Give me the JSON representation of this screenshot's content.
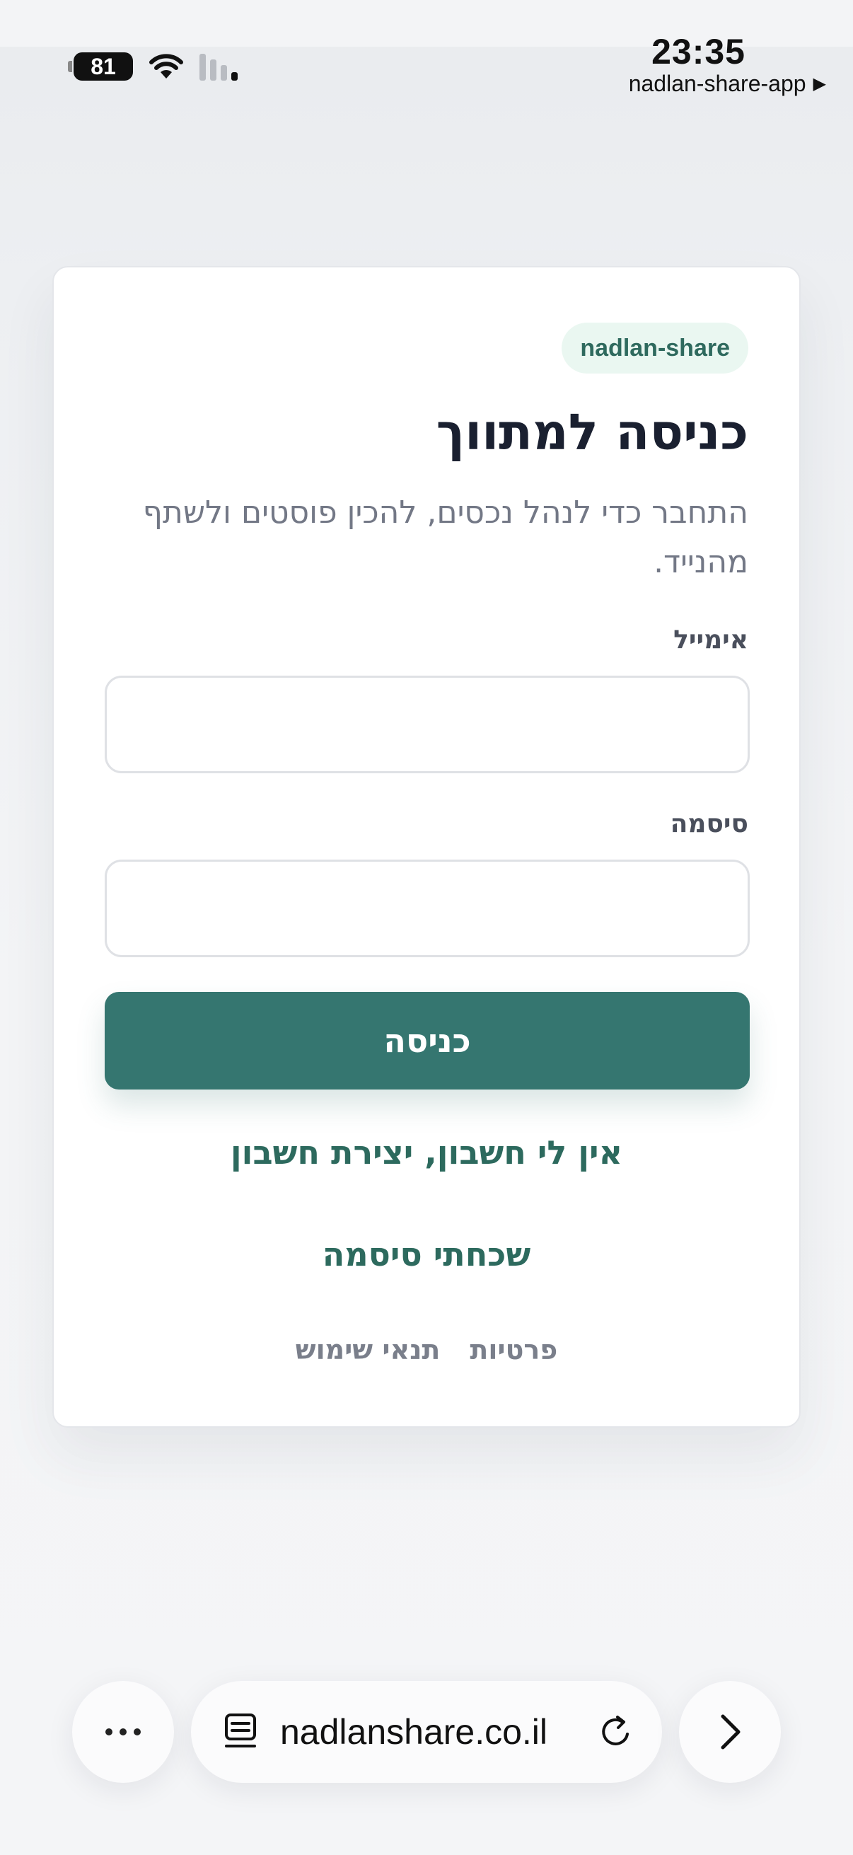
{
  "status_bar": {
    "time": "23:35",
    "app_name": "nadlan-share-app",
    "app_arrow": "▶",
    "battery": "81"
  },
  "card": {
    "badge": "nadlan-share",
    "title": "כניסה למתווך",
    "subtitle": "התחבר כדי לנהל נכסים, להכין פוסטים ולשתף מהנייד.",
    "email_label": "אימייל",
    "email_value": "",
    "password_label": "סיסמה",
    "password_value": "",
    "submit_label": "כניסה",
    "register_link": "אין לי חשבון, יצירת חשבון",
    "forgot_link": "שכחתי סיסמה",
    "footer": {
      "privacy": "פרטיות",
      "terms": "תנאי שימוש"
    }
  },
  "browser_bar": {
    "url": "nadlanshare.co.il",
    "icons": [
      "more-icon",
      "page-icon",
      "reload-icon",
      "chevron-right-icon"
    ]
  },
  "colors": {
    "accent": "#357670",
    "link": "#2d6a5e",
    "badge_bg": "#eaf7f1"
  }
}
